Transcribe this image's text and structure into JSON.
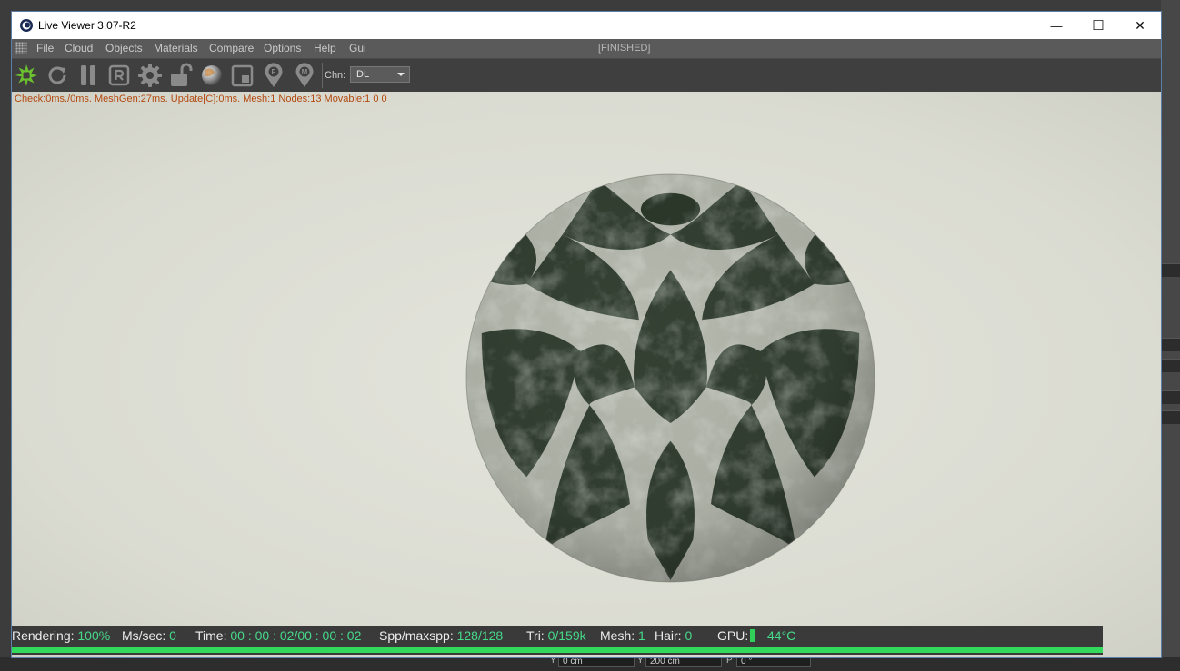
{
  "window": {
    "title": "Live Viewer 3.07-R2",
    "controls": {
      "minimize": "—",
      "maximize": "☐",
      "close": "✕"
    }
  },
  "menu": {
    "items": [
      "File",
      "Cloud",
      "Objects",
      "Materials",
      "Compare",
      "Options",
      "Help",
      "Gui"
    ],
    "render_state": "[FINISHED]"
  },
  "toolbar": {
    "icons": [
      "octane-logo-icon",
      "refresh-icon",
      "pause-icon",
      "r-icon",
      "gear-icon",
      "unlock-icon",
      "material-ball-icon",
      "region-icon",
      "focus-pin-icon",
      "material-pin-icon"
    ],
    "channel_label": "Chn:",
    "channel_value": "DL"
  },
  "viewport": {
    "info": "Check:0ms./0ms. MeshGen:27ms. Update[C]:0ms. Mesh:1 Nodes:13 Movable:1  0 0"
  },
  "status": {
    "rendering_label": "Rendering:",
    "rendering_value": "100%",
    "ms_label": "Ms/sec:",
    "ms_value": "0",
    "time_label": "Time:",
    "time_value": "00 : 00 : 02/00 : 00 : 02",
    "spp_label": "Spp/maxspp:",
    "spp_value": "128/128",
    "tri_label": "Tri:",
    "tri_value": "0/159k",
    "mesh_label": "Mesh:",
    "mesh_value": "1",
    "hair_label": "Hair:",
    "hair_value": "0",
    "gpu_label": "GPU:",
    "gpu_temp": "44°C",
    "progress": 1.0
  },
  "background_app": {
    "coord_y1_label": "Y",
    "coord_y1": "0 cm",
    "coord_y2_label": "Y",
    "coord_y2": "200 cm",
    "coord_p_label": "P",
    "coord_p": "0 °"
  },
  "colors": {
    "accent": "#46d98a",
    "progress": "#33d95a",
    "info": "#b4490e",
    "marble_dark": "#344133",
    "marble_light": "#b9bcb0"
  }
}
